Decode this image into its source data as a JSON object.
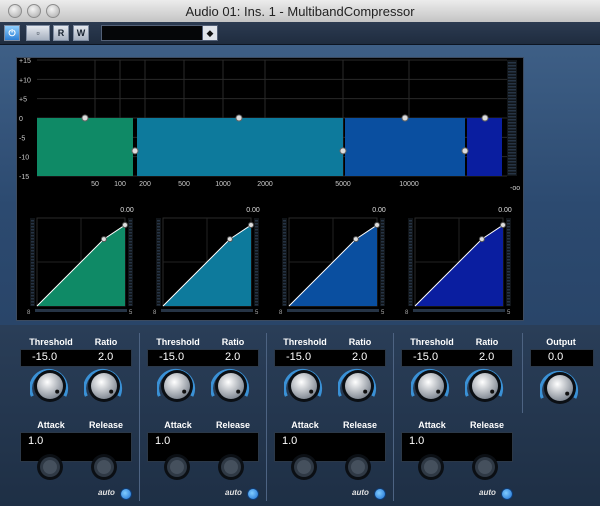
{
  "window": {
    "title": "Audio 01: Ins. 1 - MultibandCompressor"
  },
  "toolbar": {
    "power": "⏻",
    "bypass": "▫",
    "read": "R",
    "write": "W",
    "preset_value": ""
  },
  "display": {
    "db_labels": [
      "+15",
      "+10",
      "+5",
      "0",
      "-5",
      "-10",
      "-15"
    ],
    "freq_labels": [
      "50",
      "100",
      "200",
      "500",
      "1000",
      "2000",
      "5000",
      "10000"
    ],
    "neg_inf": "-oo",
    "band_colors": [
      "#0f8a66",
      "#0d7a9c",
      "#0a4fa0",
      "#0a1ea0"
    ]
  },
  "curves": [
    {
      "gain": "0.00",
      "color": "#0f8a66"
    },
    {
      "gain": "0.00",
      "color": "#0d7a9c"
    },
    {
      "gain": "0.00",
      "color": "#0a4fa0"
    },
    {
      "gain": "0.00",
      "color": "#0a1ea0"
    }
  ],
  "bands": [
    {
      "threshold_label": "Threshold",
      "threshold": "-15.0",
      "ratio_label": "Ratio",
      "ratio": "2.0",
      "attack_label": "Attack",
      "attack": "1.0",
      "release_label": "Release",
      "auto_label": "auto"
    },
    {
      "threshold_label": "Threshold",
      "threshold": "-15.0",
      "ratio_label": "Ratio",
      "ratio": "2.0",
      "attack_label": "Attack",
      "attack": "1.0",
      "release_label": "Release",
      "auto_label": "auto"
    },
    {
      "threshold_label": "Threshold",
      "threshold": "-15.0",
      "ratio_label": "Ratio",
      "ratio": "2.0",
      "attack_label": "Attack",
      "attack": "1.0",
      "release_label": "Release",
      "auto_label": "auto"
    },
    {
      "threshold_label": "Threshold",
      "threshold": "-15.0",
      "ratio_label": "Ratio",
      "ratio": "2.0",
      "attack_label": "Attack",
      "attack": "1.0",
      "release_label": "Release",
      "auto_label": "auto"
    }
  ],
  "output": {
    "label": "Output",
    "value": "0.0"
  }
}
